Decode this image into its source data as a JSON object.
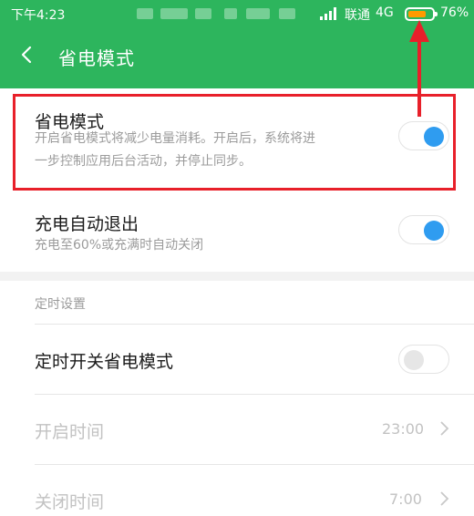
{
  "status_bar": {
    "time": "下午4:23",
    "carrier": "联通",
    "network": "4G",
    "battery_percent": "76%",
    "battery_level": 0.76,
    "battery_color": "#ff9a00"
  },
  "header": {
    "title": "省电模式",
    "background_color": "#2db55d"
  },
  "power_saving": {
    "title": "省电模式",
    "description_line1": "开启省电模式将减少电量消耗。开启后，系统将进",
    "description_line2": "一步控制应用后台活动，并停止同步。",
    "enabled": true
  },
  "auto_exit": {
    "title": "充电自动退出",
    "description": "充电至60%或充满时自动关闭",
    "enabled": true
  },
  "schedule": {
    "section_label": "定时设置",
    "toggle_title": "定时开关省电模式",
    "enabled": false,
    "start_label": "开启时间",
    "start_value": "23:00",
    "end_label": "关闭时间",
    "end_value": "7:00"
  },
  "colors": {
    "toggle_on": "#2f9cf0",
    "annotation": "#e8202a"
  }
}
